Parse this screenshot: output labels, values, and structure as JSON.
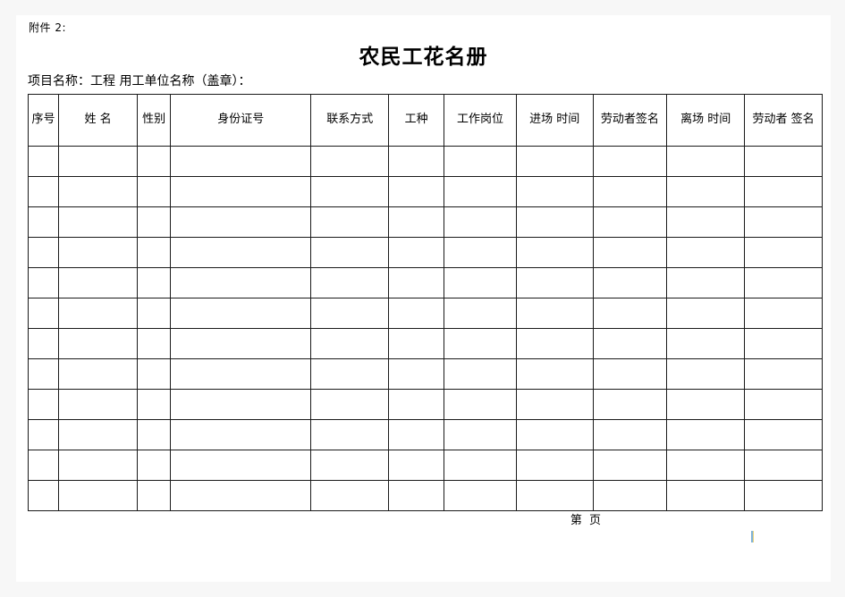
{
  "document": {
    "attachment_label": "附件 2:",
    "title": "农民工花名册",
    "project_line": "项目名称：工程 用工单位名称（盖章）：",
    "footer": "第  页"
  },
  "table": {
    "columns": [
      {
        "label": "序号",
        "name": "col-serial-number"
      },
      {
        "label": "姓 名",
        "name": "col-name"
      },
      {
        "label": "性别",
        "name": "col-gender"
      },
      {
        "label": "身份证号",
        "name": "col-id-number"
      },
      {
        "label": "联系方式",
        "name": "col-contact"
      },
      {
        "label": "工种",
        "name": "col-work-type"
      },
      {
        "label": "工作岗位",
        "name": "col-job-position"
      },
      {
        "label": "进场 时间",
        "name": "col-entry-time"
      },
      {
        "label": "劳动者签名",
        "name": "col-worker-signature-entry"
      },
      {
        "label": "离场 时间",
        "name": "col-exit-time"
      },
      {
        "label": "劳动者 签名",
        "name": "col-worker-signature-exit"
      }
    ],
    "row_count": 12,
    "rows": [
      [
        "",
        "",
        "",
        "",
        "",
        "",
        "",
        "",
        "",
        "",
        ""
      ],
      [
        "",
        "",
        "",
        "",
        "",
        "",
        "",
        "",
        "",
        "",
        ""
      ],
      [
        "",
        "",
        "",
        "",
        "",
        "",
        "",
        "",
        "",
        "",
        ""
      ],
      [
        "",
        "",
        "",
        "",
        "",
        "",
        "",
        "",
        "",
        "",
        ""
      ],
      [
        "",
        "",
        "",
        "",
        "",
        "",
        "",
        "",
        "",
        "",
        ""
      ],
      [
        "",
        "",
        "",
        "",
        "",
        "",
        "",
        "",
        "",
        "",
        ""
      ],
      [
        "",
        "",
        "",
        "",
        "",
        "",
        "",
        "",
        "",
        "",
        ""
      ],
      [
        "",
        "",
        "",
        "",
        "",
        "",
        "",
        "",
        "",
        "",
        ""
      ],
      [
        "",
        "",
        "",
        "",
        "",
        "",
        "",
        "",
        "",
        "",
        ""
      ],
      [
        "",
        "",
        "",
        "",
        "",
        "",
        "",
        "",
        "",
        "",
        ""
      ],
      [
        "",
        "",
        "",
        "",
        "",
        "",
        "",
        "",
        "",
        "",
        ""
      ],
      [
        "",
        "",
        "",
        "",
        "",
        "",
        "",
        "",
        "",
        "",
        ""
      ]
    ]
  },
  "style": {
    "page_background": "#ffffff",
    "canvas_background": "#f7f7f7",
    "border_color": "#1a1a1a",
    "soft_border_color": "#9a9a9a",
    "text_color": "#000000"
  }
}
